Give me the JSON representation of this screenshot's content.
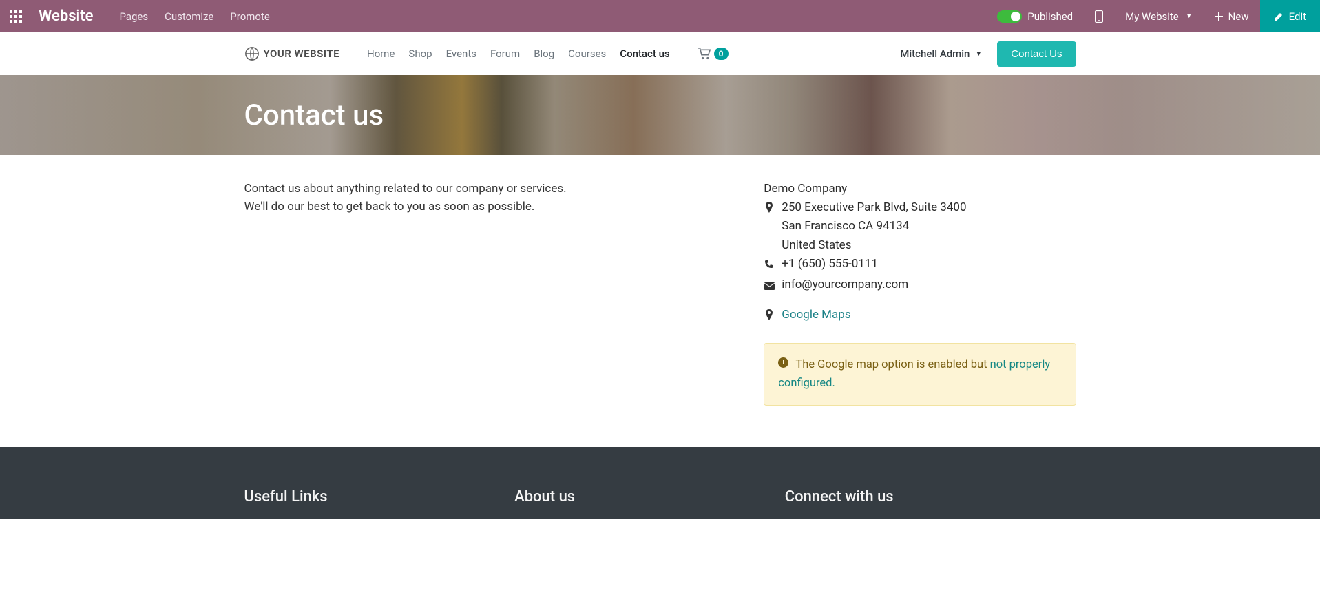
{
  "admin": {
    "brand": "Website",
    "links": {
      "pages": "Pages",
      "customize": "Customize",
      "promote": "Promote"
    },
    "published": "Published",
    "my_website": "My Website",
    "new": "New",
    "edit": "Edit"
  },
  "nav": {
    "logo_text": "YOUR WEBSITE",
    "items": {
      "home": "Home",
      "shop": "Shop",
      "events": "Events",
      "forum": "Forum",
      "blog": "Blog",
      "courses": "Courses",
      "contact": "Contact us"
    },
    "cart_count": "0",
    "user": "Mitchell Admin",
    "contact_btn": "Contact Us"
  },
  "hero": {
    "title": "Contact us"
  },
  "main": {
    "intro_line1": "Contact us about anything related to our company or services.",
    "intro_line2": "We'll do our best to get back to you as soon as possible.",
    "company_name": "Demo Company",
    "address_line1": "250 Executive Park Blvd, Suite 3400",
    "address_line2": "San Francisco CA 94134",
    "address_line3": "United States",
    "phone": "+1 (650) 555-0111",
    "email": "info@yourcompany.com",
    "maps_label": "Google Maps",
    "alert_text": "The Google map option is enabled but ",
    "alert_link": "not properly configured."
  },
  "footer": {
    "col1_title": "Useful Links",
    "col2_title": "About us",
    "col3_title": "Connect with us"
  }
}
